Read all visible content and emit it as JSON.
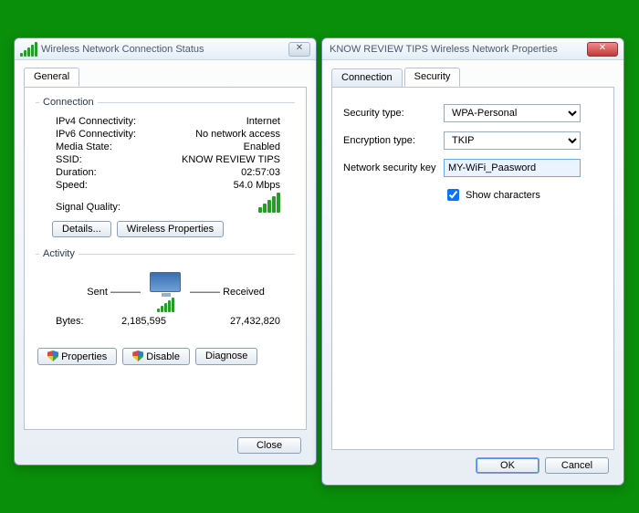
{
  "status_window": {
    "title": "Wireless Network Connection Status",
    "tabs": {
      "general": "General"
    },
    "connection_legend": "Connection",
    "rows": {
      "ipv4_label": "IPv4 Connectivity:",
      "ipv4_value": "Internet",
      "ipv6_label": "IPv6 Connectivity:",
      "ipv6_value": "No network access",
      "media_label": "Media State:",
      "media_value": "Enabled",
      "ssid_label": "SSID:",
      "ssid_value": "KNOW REVIEW TIPS",
      "duration_label": "Duration:",
      "duration_value": "02:57:03",
      "speed_label": "Speed:",
      "speed_value": "54.0 Mbps",
      "signal_label": "Signal Quality:"
    },
    "details_btn": "Details...",
    "wprops_btn": "Wireless Properties",
    "activity_legend": "Activity",
    "sent_label": "Sent",
    "received_label": "Received",
    "bytes_label": "Bytes:",
    "bytes_sent": "2,185,595",
    "bytes_received": "27,432,820",
    "properties_btn": "Properties",
    "disable_btn": "Disable",
    "diagnose_btn": "Diagnose",
    "close_btn": "Close"
  },
  "props_window": {
    "title": "KNOW REVIEW TIPS Wireless Network Properties",
    "tabs": {
      "connection": "Connection",
      "security": "Security"
    },
    "sectype_label": "Security type:",
    "sectype_value": "WPA-Personal",
    "enctype_label": "Encryption type:",
    "enctype_value": "TKIP",
    "key_label": "Network security key",
    "key_value": "MY-WiFi_Paasword",
    "showchars_label": "Show characters",
    "showchars_checked": true,
    "ok_btn": "OK",
    "cancel_btn": "Cancel"
  }
}
